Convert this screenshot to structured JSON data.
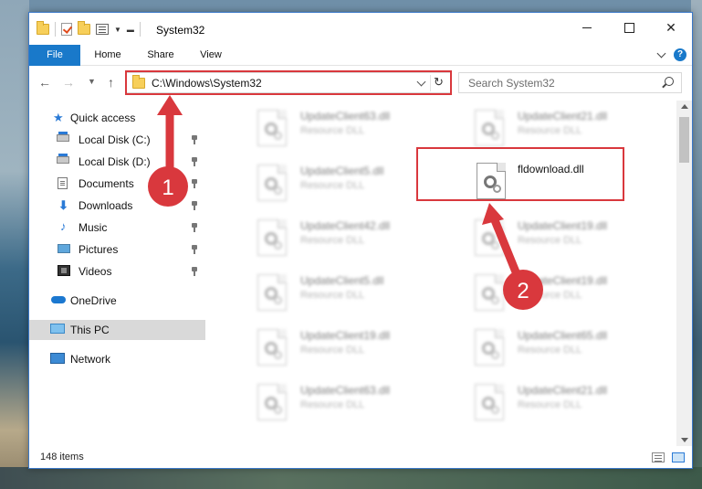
{
  "window": {
    "title": "System32",
    "controls": {
      "minimize": "",
      "maximize": "",
      "close": "✕"
    }
  },
  "ribbon": {
    "tabs": [
      "File",
      "Home",
      "Share",
      "View"
    ],
    "help": "?"
  },
  "nav": {
    "address": "C:\\Windows\\System32",
    "search_placeholder": "Search System32"
  },
  "sidebar": {
    "items": [
      {
        "label": "Quick access",
        "icon": "star-icon",
        "pinned": false
      },
      {
        "label": "Local Disk (C:)",
        "icon": "drive-icon",
        "pinned": true
      },
      {
        "label": "Local Disk (D:)",
        "icon": "drive-icon",
        "pinned": true
      },
      {
        "label": "Documents",
        "icon": "documents-icon",
        "pinned": true
      },
      {
        "label": "Downloads",
        "icon": "download-icon",
        "pinned": true
      },
      {
        "label": "Music",
        "icon": "music-icon",
        "pinned": true
      },
      {
        "label": "Pictures",
        "icon": "pictures-icon",
        "pinned": true
      },
      {
        "label": "Videos",
        "icon": "videos-icon",
        "pinned": true
      },
      {
        "label": "OneDrive",
        "icon": "onedrive-icon",
        "pinned": false
      },
      {
        "label": "This PC",
        "icon": "computer-icon",
        "pinned": false,
        "selected": true
      },
      {
        "label": "Network",
        "icon": "network-icon",
        "pinned": false
      }
    ]
  },
  "files": {
    "left_column": [
      {
        "name": "UpdateClient63.dll",
        "type": "Resource DLL"
      },
      {
        "name": "UpdateClient5.dll",
        "type": "Resource DLL"
      },
      {
        "name": "UpdateClient42.dll",
        "type": "Resource DLL"
      },
      {
        "name": "UpdateClient5.dll",
        "type": "Resource DLL"
      },
      {
        "name": "UpdateClient19.dll",
        "type": "Resource DLL"
      },
      {
        "name": "UpdateClient63.dll",
        "type": "Resource DLL"
      }
    ],
    "right_column": [
      {
        "name": "UpdateClient21.dll",
        "type": "Resource DLL"
      },
      {
        "name": "fldownload.dll",
        "type": ""
      },
      {
        "name": "UpdateClient19.dll",
        "type": "Resource DLL"
      },
      {
        "name": "UpdateClient19.dll",
        "type": "Resource DLL"
      },
      {
        "name": "UpdateClient65.dll",
        "type": "Resource DLL"
      },
      {
        "name": "UpdateClient21.dll",
        "type": "Resource DLL"
      }
    ]
  },
  "status": {
    "item_count": "148 items"
  },
  "annotations": {
    "step1": "1",
    "step2": "2",
    "color": "#d9383d"
  }
}
